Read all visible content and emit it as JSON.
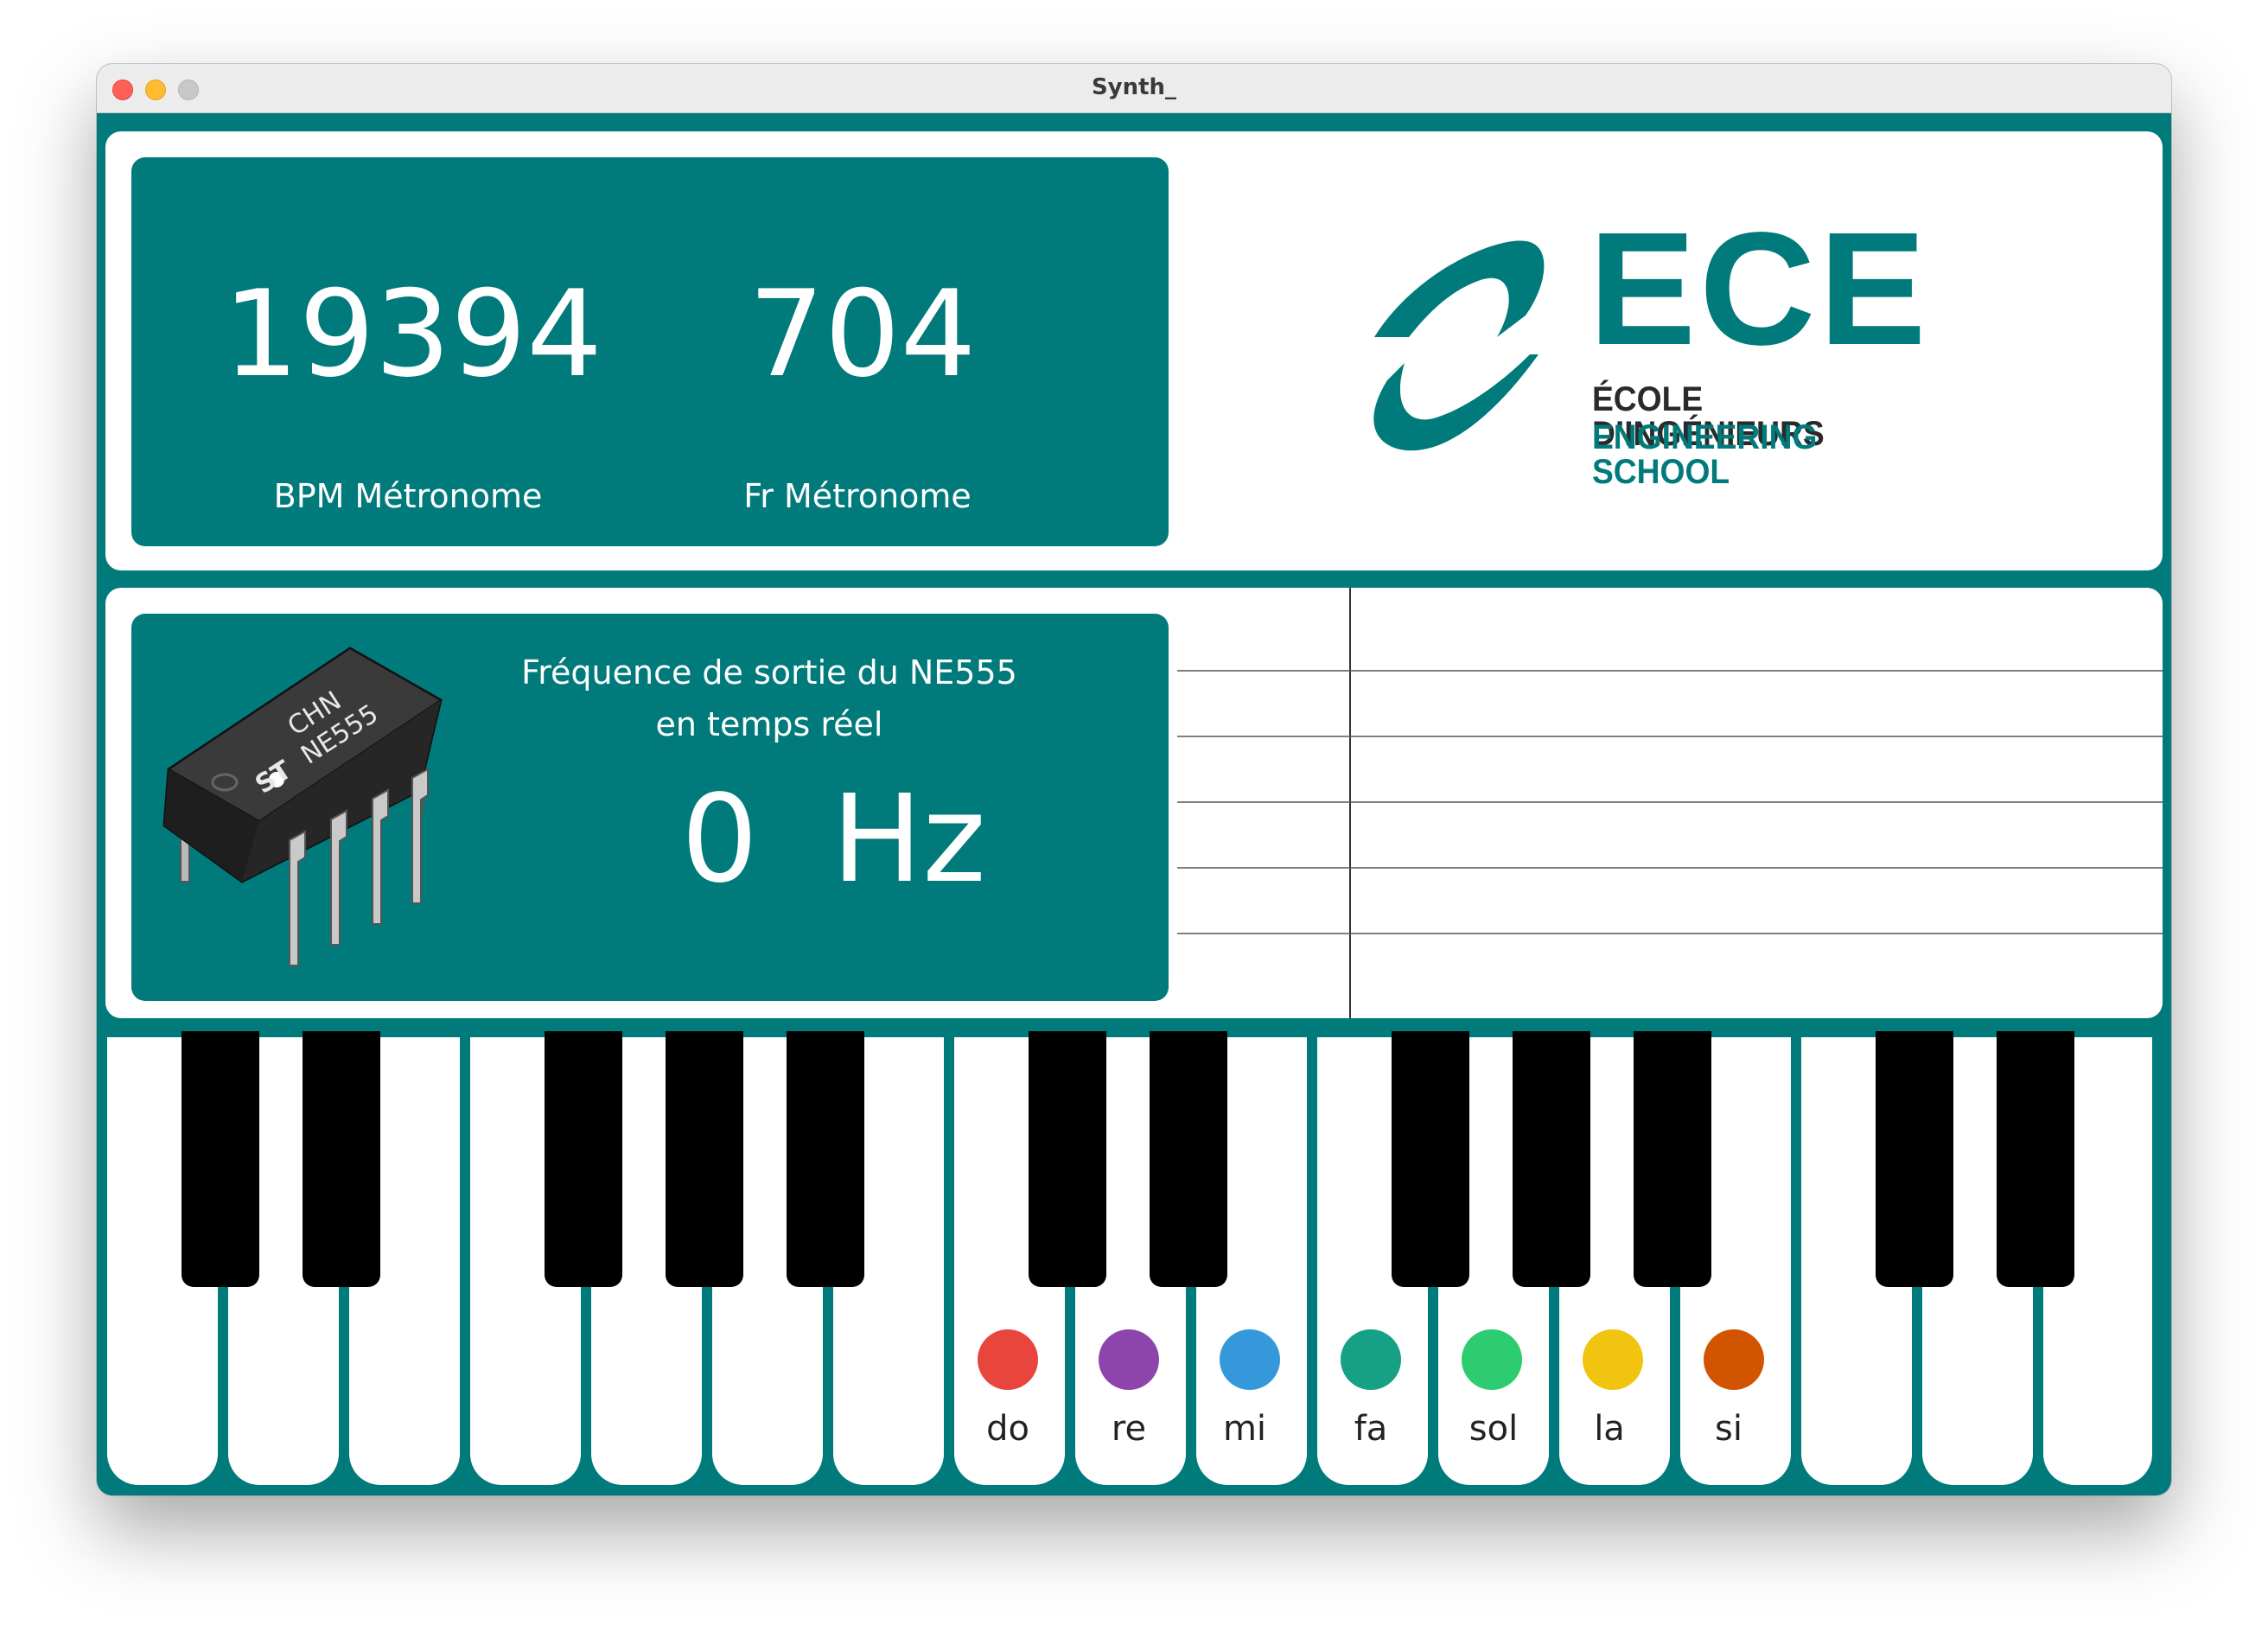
{
  "window": {
    "title": "Synth_"
  },
  "metronome": {
    "bpm_value": "19394",
    "bpm_label": "BPM Métronome",
    "fr_value": "704",
    "fr_label": "Fr Métronome"
  },
  "logo": {
    "wordmark": "ECE",
    "line1": "ÉCOLE D’INGÉNIEURS",
    "line2": "ENGINEERING SCHOOL",
    "color": "#017a7b"
  },
  "chip": {
    "marking_top": "CHN",
    "marking_bottom": "NE555",
    "brand": "ST"
  },
  "frequency": {
    "title_line1": "Fréquence de sortie du NE555",
    "title_line2": "en temps réel",
    "value": "0",
    "unit": "Hz"
  },
  "notes": [
    {
      "label": "do",
      "color": "#e8453c"
    },
    {
      "label": "re",
      "color": "#8e44ad"
    },
    {
      "label": "mi",
      "color": "#3498db"
    },
    {
      "label": "fa",
      "color": "#16a085"
    },
    {
      "label": "sol",
      "color": "#2ecc71"
    },
    {
      "label": "la",
      "color": "#f1c40f"
    },
    {
      "label": "si",
      "color": "#d35400"
    }
  ],
  "colors": {
    "accent": "#017a7b",
    "background_panel": "#ffffff"
  }
}
